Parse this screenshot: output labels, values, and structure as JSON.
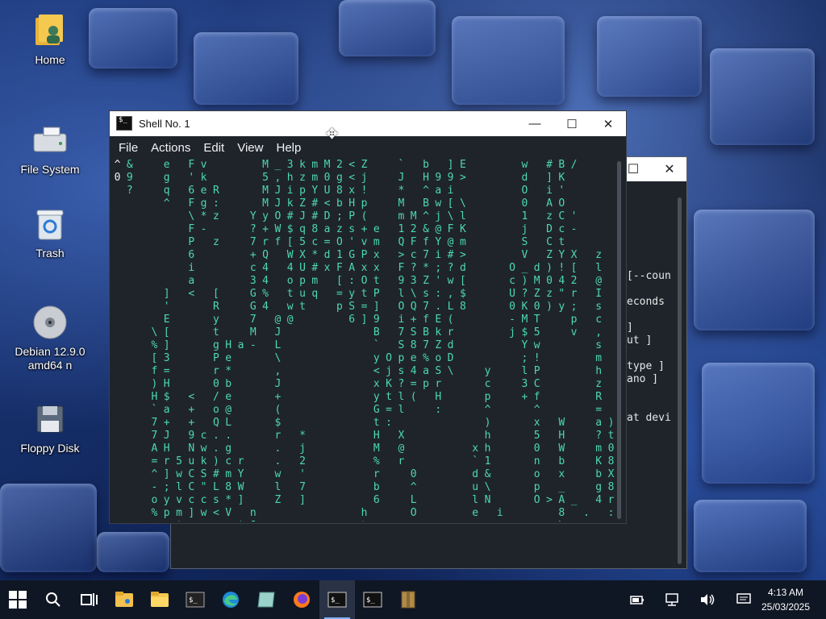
{
  "desktop": {
    "icons": [
      {
        "label": "Home",
        "icon": "home-folder-icon"
      },
      {
        "label": "File System",
        "icon": "drive-icon"
      },
      {
        "label": "Trash",
        "icon": "trash-icon"
      },
      {
        "label": "Debian 12.9.0 amd64 n",
        "icon": "cd-icon"
      },
      {
        "label": "Floppy Disk",
        "icon": "floppy-icon"
      }
    ]
  },
  "background_window": {
    "visible_text": [
      "[--coun",
      "",
      "econds",
      "",
      "]",
      "ut ]",
      "",
      "type ]",
      "ano ]",
      "",
      "",
      "at devi"
    ]
  },
  "terminal_window": {
    "title": "Shell No. 1",
    "menu": [
      "File",
      "Actions",
      "Edit",
      "View",
      "Help"
    ],
    "matrix_columns": [
      {
        "text": "^\n0",
        "white": true
      },
      {
        "text": "&\n9\n?",
        "white": false
      },
      {
        "text": "",
        "white": false
      },
      {
        "text": "\n\n\n\n\n\n\n\n\n\n\n\n\n\\\n%\n[\nf\n)\nH\n`\n7\n7\nA\n=\n^\n-\no\n%",
        "white": false
      },
      {
        "text": "e\ng\nq\n^\n\n\n\n\n\n\n]\n'\nE\n[\n]\n3\n=\nH\n$\na\n+\nJ\nH\nr\n]\n;\ny\np",
        "white": false
      },
      {
        "text": "\n\n\n\n\n\n\n\n\n\n\n\n\n\n\n\n\n\n\n\n\n\n\n5\nw\nl\nv\nm\n*",
        "white": false
      },
      {
        "text": "F\n'\n6\nF\n\\\nF\nP\n6\ni\na\n<\n\n\n\n\n\n\n\n<\n+\n+\n9\nN\nu\nC\nC\nc\n]",
        "white": false
      },
      {
        "text": "v\nk\ne\ng\n*\n-\n\n\n\n\n\n\n\n\n\n\n\n\n\n\n\nc\nw\nk\nS\n\"\nc\nw",
        "white": false
      },
      {
        "text": "\n\nR\n:\nz\n\nz\n\n\n\n[\nR\ny\nt\ng\nP\nr\n0\n/\no\nQ\n.\n.\n)\n#\nL\ns\n<",
        "white": false
      },
      {
        "text": "\n\n\n\n\n\n\n\n\n\n\n\n\n\nH\ne\n*\nb\ne\n@\nL\n.\ng\nc\nm\n8\n*\nV\n-",
        "white": false
      },
      {
        "text": "\n\n\n\n\n\n\n\n\n\n\n\n\n\na\n\n\n\n\n\n\n\n\nr\nY\nW\n]\n\n*\nf",
        "white": false
      },
      {
        "text": "\n\n\n\nY\n?\n7\n+\nc\n3\nG\nG\n7\nM\n-\n\n\n\n\n\n\n\n\n\n\n\n\nn\nJ",
        "white": false
      },
      {
        "text": "M\n5\nM\nM\ny\n+\nr\nQ\n4\n4\n%\n4\n\n\n\n\n\n\n\n\n\n\n\n\n\n\n\n\n",
        "white": false
      },
      {
        "text": "_\n,\nJ\nJ\nO\nW\nf\n\n\n\n\n\n@\nJ\nL\n\\\n,\nJ\n+\n(\n$\nr\n.\n.\nw\nl\nZ",
        "white": false
      },
      {
        "text": "3\nh\ni\nk\n#\n$\n[\nW\n4\no\nt\nw\n@\n\n\n\n\n\n\n\n\n\n\n\n\n\n",
        "white": false
      },
      {
        "text": "k\nz\np\nZ\nJ\nq\n5\nX\nU\np\nu\nt\n\n\n\n\n\n\n\n\n\n*\nj\n2\n'\n7\n]",
        "white": false
      },
      {
        "text": "m\nm\nY\n#\n#\n8\nc\n*\n#\nm\nq\n\n\n\n\n\n\n\n\n\n\n\n\n\n\n\n\n",
        "white": false
      },
      {
        "text": "M\n0\nU\n<\nD\na\n=\nd\nx\n\n\n\n\n\n\n\n\n\n\n\n\n\n\n\n\n\n\n",
        "white": false
      },
      {
        "text": "2\ng\n8\nb\n;\nz\nO\n1\nF\n[\n=\np\n\n\n\n\n\n\n\n\n\n\n\n\n\n\n\n",
        "white": false
      },
      {
        "text": "<\n<\nx\nH\nP\ns\n'\nG\nA\n:\ny\nS\n6\n\n\n\n\n\n\n\n\n\n\n\n\n\n\n",
        "white": false
      },
      {
        "text": "Z\nj\n!\np\n(\n+\nv\nP\nx\nO\nt\n=\n]\n\n\n\n\n\n\n\n\n\n\n\n\n\n\nh\n%",
        "white": false
      },
      {
        "text": "\n\n\n\n\ne\nm\nx\nx\nt\nP\n]\n9\nB\n`\ny\n<\nx\ny\nG\nt\nH\nM\n%\nr\nb\n6",
        "white": false
      },
      {
        "text": "\n\n\n\n\n\n\n\n\n\n\n\n\n\n\nO\nj\nK\nt\n=\n:\n\n\n\n\n\n",
        "white": false
      },
      {
        "text": "`\nJ\n*\nM\nm\n1\nQ\n>\nF\n9\nl\nO\ni\n7\nS\np\ns\n?\nl\nl\n\nX\n@\nr\n\n\n",
        "white": false
      },
      {
        "text": "\n\n\n\nM\n2\nF\nc\n?\n3\n\\\nQ\n+\nS\n8\ne\n4\n=\n(\n\n\n\n\n\n0\n^\nL\nO",
        "white": false
      },
      {
        "text": "b\nH\n^\nB\n^\n&\nf\n7\n*\nZ\ns\n7\nf\nB\n7\n%\na\np\n\n\n\n\n\n\n\n\n\n",
        "white": false
      },
      {
        "text": "\n9\na\nw\nj\n@\nY\ni\n;\n'\n:\n.\nE\nk\nZ\no\nS\nr\nH\n:\n\n\n\n\n\n\n\n",
        "white": false
      },
      {
        "text": "]\n9\ni\n[\n\\\nF\n@\n#\n?\nw\n,\nL\n(\nr\nd\nD\n\\\n\n\n\n\n\n\n\n\n\n",
        "white": false
      },
      {
        "text": "E\n>\n\n\\\nl\nK\nm\n>\nd\n[\n$\n8\n\n\n\n\n\n\n\n\n\n\n\n\n\n\n\n",
        "white": false
      },
      {
        "text": "\n\n\n\n\n\n\n\n\n\n\n\n\n\n\n\n\n\n\n\n\n\nx\n`\nd\nu\nl\ne",
        "white": false
      },
      {
        "text": "\n\n\n\n\n\n\n\n\n\n\n\n\n\n\n\ny\nc\np\n^\n)\nh\nh\n1\n&\n\\\nN",
        "white": false
      },
      {
        "text": "\n\n\n\n\n\n\n\n\n\n\n\n\n\n\n\n\n\n\n\n\n\n\n\n\n\n\ni",
        "white": false
      },
      {
        "text": "\n\n\n\n\n\n\n\nO\nc\nU\n0\n-\nj\n\n\n\n\n\n\n\n\n\n\n\n\n\n",
        "white": false
      },
      {
        "text": "w\nd\nO\n0\n1\nj\nS\nV\n_\n)\n?\nK\nM\n$\nY\n;\nl\n3\n+\n\n\n\n\n\n\n\n\n",
        "white": false
      },
      {
        "text": "\n\n\n\n\n\n\n\nd\nM\nZ\n0\nT\n5\nw\n!\nP\nC\nf\n^\nx\n5\n0\nn\no\np\nO",
        "white": false
      },
      {
        "text": "#\n]\ni\nA\nz\nD\nC\nZ\n)\n0\nz\n)\n\n\n\n\n\n\n\n\n\n\n\n\n\n\n>",
        "white": false
      },
      {
        "text": "B\nK\n'\nO\nC\nc\nt\nY\n!\n4\n\"\ny\n\n\n\n\n\n\n\n\nW\nH\nW\nb\nx\n_\nA\n8\n\\",
        "white": false
      },
      {
        "text": "/\n\n\n\n'\n-\n\nX\n[\n2\nr\n;\np\nv\n\n\n\n\n\n\n\n\n\n\n\n\n_",
        "white": false
      },
      {
        "text": "\n\n\n\n\n\n\n\n\n\n\n\n\n\n\n\n\n\n\n\n\n\n\n\n\n\n\n.",
        "white": false
      },
      {
        "text": "\n\n\n\n\n\n\nz\nl\n@\nI\ns\nc\n,\ns\nm\nh\nz\nR\n=\na\n?\nm\nK\nb\ng\n4",
        "white": false
      },
      {
        "text": "\n\n\n\n\n\n\n\n\n\n\n\n\n\n\n\n\n\n\n\n)\nt\n0\n8\nX\n8\nr\n:",
        "white": false
      }
    ]
  },
  "taskbar": {
    "items": [
      {
        "name": "start-button",
        "icon": "windows-logo-icon"
      },
      {
        "name": "search-button",
        "icon": "search-icon"
      },
      {
        "name": "task-view-button",
        "icon": "task-view-icon"
      },
      {
        "name": "taskbar-file-manager-1",
        "icon": "folder-user-icon"
      },
      {
        "name": "taskbar-file-manager-2",
        "icon": "folder-icon"
      },
      {
        "name": "taskbar-terminal-pinned",
        "icon": "terminal-icon"
      },
      {
        "name": "taskbar-edge",
        "icon": "edge-icon"
      },
      {
        "name": "taskbar-app-green",
        "icon": "app-icon"
      },
      {
        "name": "taskbar-firefox",
        "icon": "firefox-icon"
      },
      {
        "name": "taskbar-terminal-active",
        "icon": "terminal-icon"
      },
      {
        "name": "taskbar-terminal-2",
        "icon": "terminal-icon"
      },
      {
        "name": "taskbar-archive",
        "icon": "archive-icon"
      }
    ],
    "time": "4:13 AM",
    "date": "25/03/2025"
  }
}
